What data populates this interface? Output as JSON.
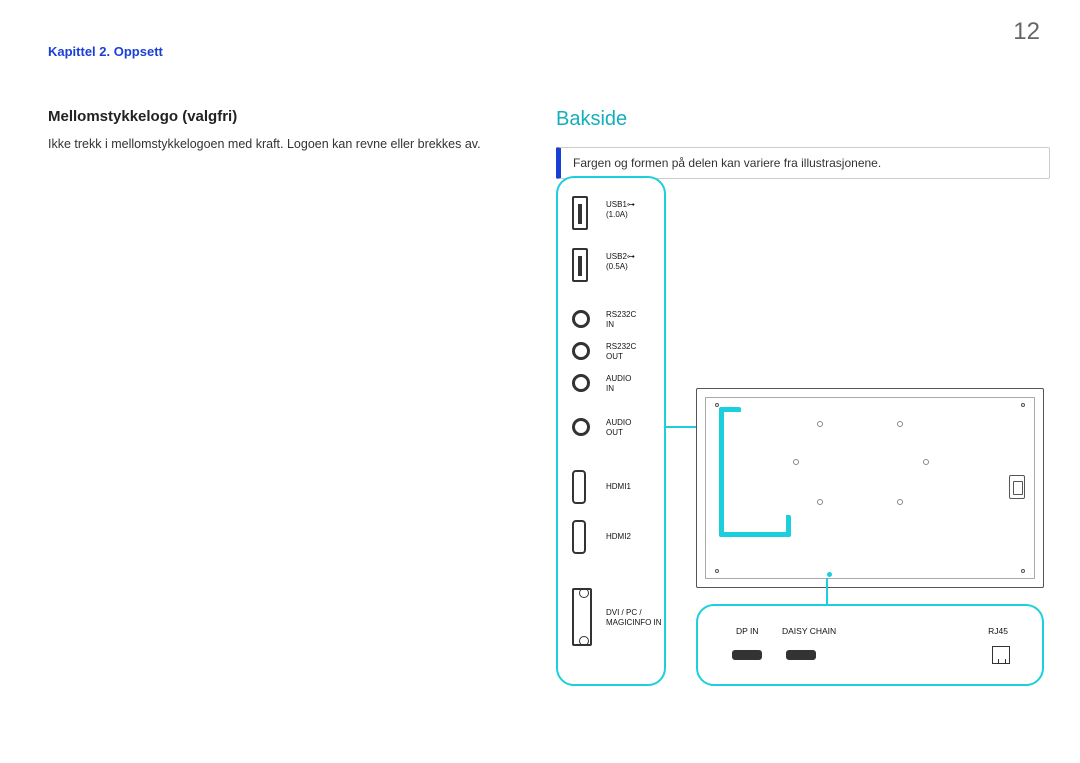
{
  "page_number": "12",
  "chapter": "Kapittel 2. Oppsett",
  "left_section": {
    "heading": "Mellomstykkelogo (valgfri)",
    "body": "Ikke trekk i mellomstykkelogoen med kraft. Logoen kan revne eller brekkes av."
  },
  "right_section": {
    "heading": "Bakside",
    "info": "Fargen og formen på delen kan variere fra illustrasjonene."
  },
  "ports": {
    "usb1_line1": "USB1",
    "usb1_line2": "(1.0A)",
    "usb2_line1": "USB2",
    "usb2_line2": "(0.5A)",
    "rs232c_in_line1": "RS232C",
    "rs232c_in_line2": "IN",
    "rs232c_out_line1": "RS232C",
    "rs232c_out_line2": "OUT",
    "audio_in_line1": "AUDIO",
    "audio_in_line2": "IN",
    "audio_out_line1": "AUDIO",
    "audio_out_line2": "OUT",
    "hdmi1": "HDMI1",
    "hdmi2": "HDMI2",
    "dvi_line1": "DVI / PC /",
    "dvi_line2": "MAGICINFO IN"
  },
  "bottom_ports": {
    "dp_in": "DP IN",
    "daisy_chain": "DAISY CHAIN",
    "rj45": "RJ45"
  }
}
